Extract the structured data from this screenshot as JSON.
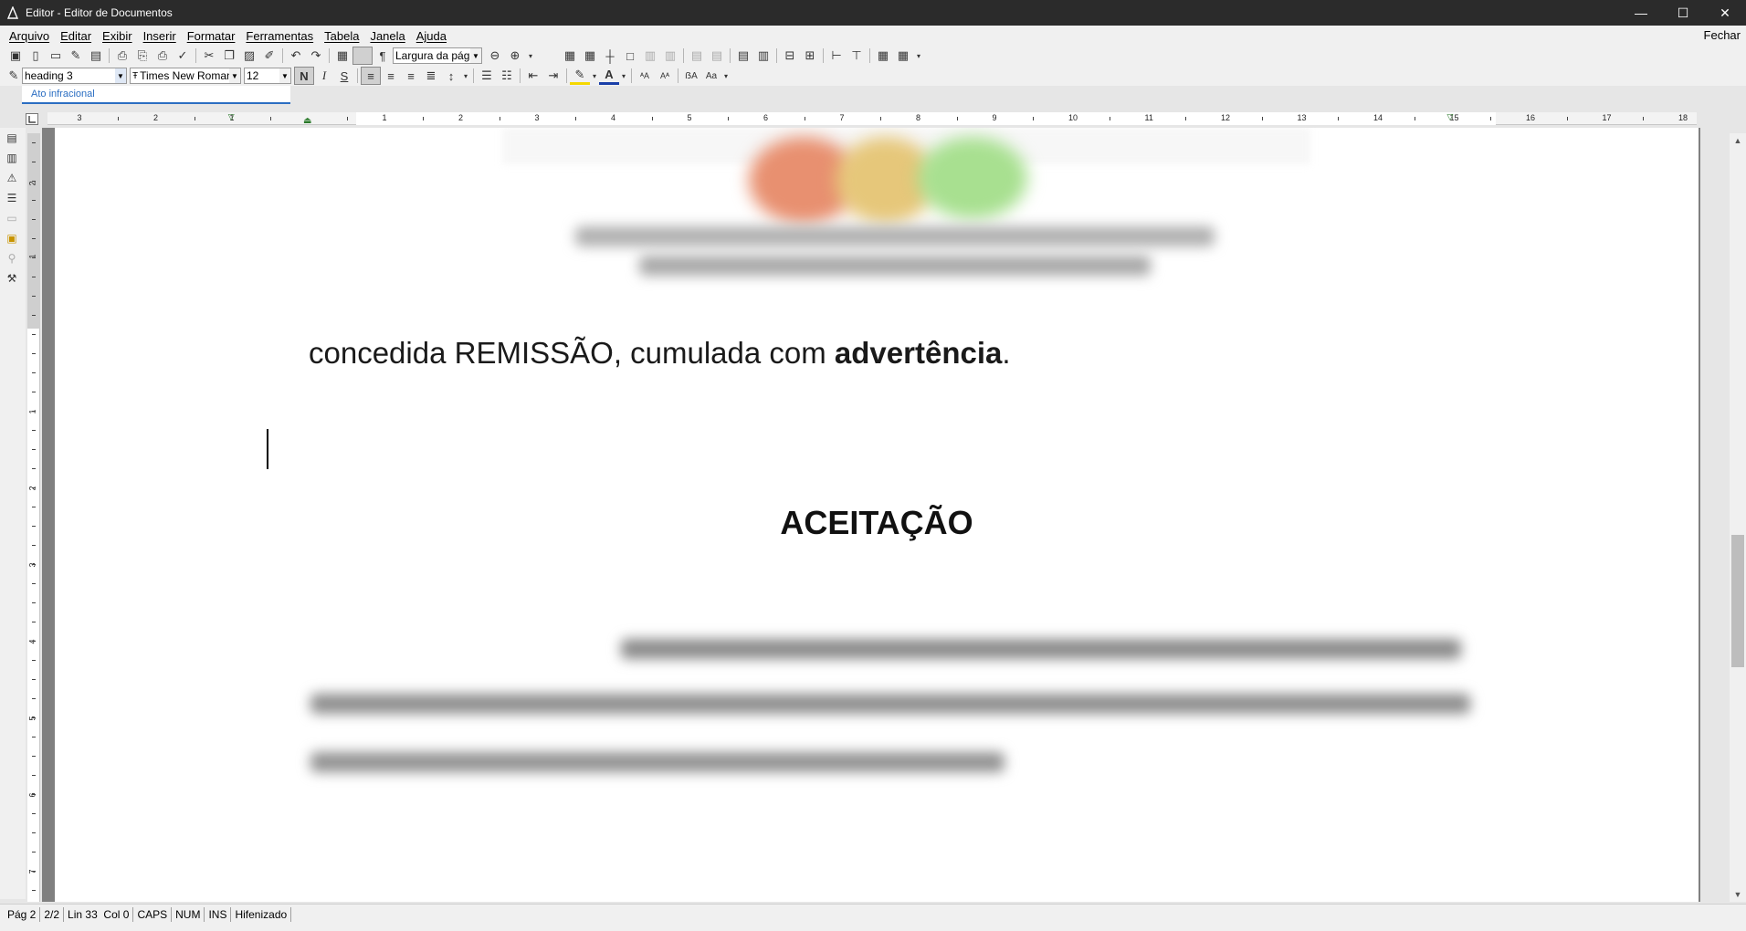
{
  "window": {
    "title": "Editor - Editor de Documentos",
    "minimize": "—",
    "maximize": "☐",
    "close": "✕"
  },
  "menu": {
    "items": [
      "Arquivo",
      "Editar",
      "Exibir",
      "Inserir",
      "Formatar",
      "Ferramentas",
      "Tabela",
      "Janela",
      "Ajuda"
    ],
    "close_label": "Fechar"
  },
  "toolbar": {
    "zoom_value": "Largura da págin",
    "style_value": "heading 3",
    "font_value": "Times New Roman",
    "size_value": "12",
    "bold_label": "N",
    "italic_label": "I",
    "strike_label": "S"
  },
  "autotext": {
    "item": "Ato infracional"
  },
  "ruler": {
    "numbers": [
      "3",
      "2",
      "1",
      "1",
      "2",
      "3",
      "4",
      "5",
      "6",
      "7",
      "8",
      "9",
      "10",
      "11",
      "12",
      "13",
      "14",
      "15",
      "16",
      "17",
      "18"
    ]
  },
  "document": {
    "text_line_part1": "concedida REMISSÃO, cumulada com ",
    "text_line_bold": "advertência",
    "text_line_end": ".",
    "heading": "ACEITAÇÃO"
  },
  "status": {
    "page": "Pág 2",
    "pages": "2/2",
    "position": "Lin 33  Col 0",
    "caps": "CAPS",
    "num": "NUM",
    "ins": "INS",
    "hyphenation": "Hifenizado"
  },
  "colors": {
    "titlebar": "#2b2b2b",
    "accent": "#2b6ec2",
    "page_bg": "#808080"
  }
}
